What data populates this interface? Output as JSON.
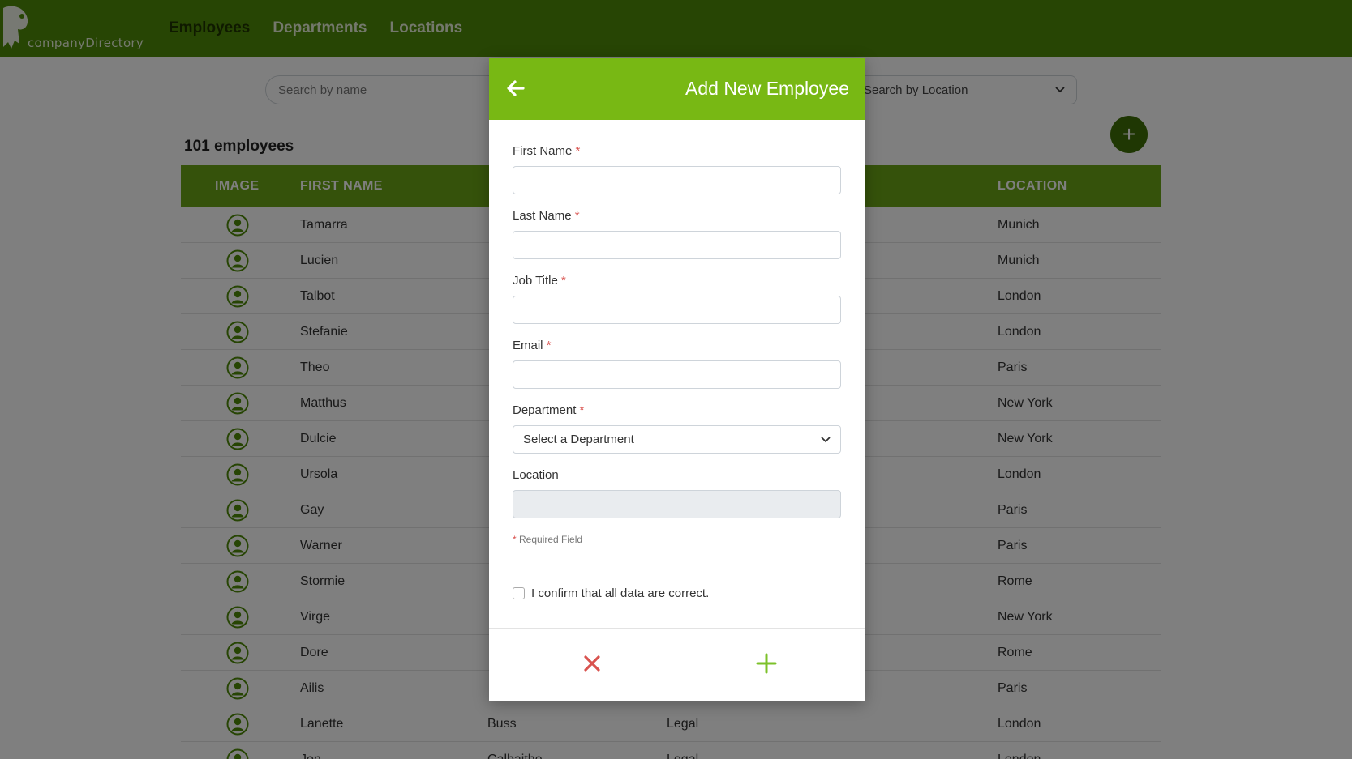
{
  "brand": {
    "name": "companyDirectory"
  },
  "nav": {
    "items": [
      {
        "label": "Employees",
        "active": true
      },
      {
        "label": "Departments",
        "active": false
      },
      {
        "label": "Locations",
        "active": false
      }
    ]
  },
  "search": {
    "placeholder": "Search by name"
  },
  "location_filter": {
    "selected": "Search by Location"
  },
  "employee_count": "101 employees",
  "table": {
    "headers": [
      "IMAGE",
      "FIRST NAME",
      "LOCATION"
    ],
    "rows": [
      {
        "first": "Tamarra",
        "last": "",
        "dept": "",
        "location": "Munich"
      },
      {
        "first": "Lucien",
        "last": "",
        "dept": "",
        "location": "Munich"
      },
      {
        "first": "Talbot",
        "last": "",
        "dept": "",
        "location": "London"
      },
      {
        "first": "Stefanie",
        "last": "",
        "dept": "",
        "location": "London"
      },
      {
        "first": "Theo",
        "last": "",
        "dept": "",
        "location": "Paris"
      },
      {
        "first": "Matthus",
        "last": "",
        "dept": "",
        "location": "New York"
      },
      {
        "first": "Dulcie",
        "last": "",
        "dept": "",
        "location": "New York"
      },
      {
        "first": "Ursola",
        "last": "",
        "dept": "",
        "location": "London"
      },
      {
        "first": "Gay",
        "last": "",
        "dept": "",
        "location": "Paris"
      },
      {
        "first": "Warner",
        "last": "",
        "dept": "",
        "location": "Paris"
      },
      {
        "first": "Stormie",
        "last": "",
        "dept": "",
        "location": "Rome"
      },
      {
        "first": "Virge",
        "last": "",
        "dept": "",
        "location": "New York"
      },
      {
        "first": "Dore",
        "last": "",
        "dept": "",
        "location": "Rome"
      },
      {
        "first": "Ailis",
        "last": "",
        "dept": "",
        "location": "Paris"
      },
      {
        "first": "Lanette",
        "last": "Buss",
        "dept": "Legal",
        "location": "London"
      },
      {
        "first": "Jon",
        "last": "Calbaithe",
        "dept": "Legal",
        "location": "London"
      }
    ]
  },
  "modal": {
    "title": "Add New Employee",
    "fields": [
      {
        "label": "First Name",
        "required": "*",
        "value": ""
      },
      {
        "label": "Last Name",
        "required": "*",
        "value": ""
      },
      {
        "label": "Job Title",
        "required": "*",
        "value": ""
      },
      {
        "label": "Email",
        "required": "*",
        "value": ""
      }
    ],
    "department": {
      "label": "Department",
      "required": "*",
      "selected": "Select a Department"
    },
    "location": {
      "label": "Location",
      "value": ""
    },
    "required_note": {
      "star": "*",
      "text": " Required Field"
    },
    "confirm_text": "I confirm that all data are correct."
  },
  "colors": {
    "nav": "#4f8a08",
    "header": "#78b814",
    "danger": "#d9534f",
    "accent": "#7cc12a"
  }
}
